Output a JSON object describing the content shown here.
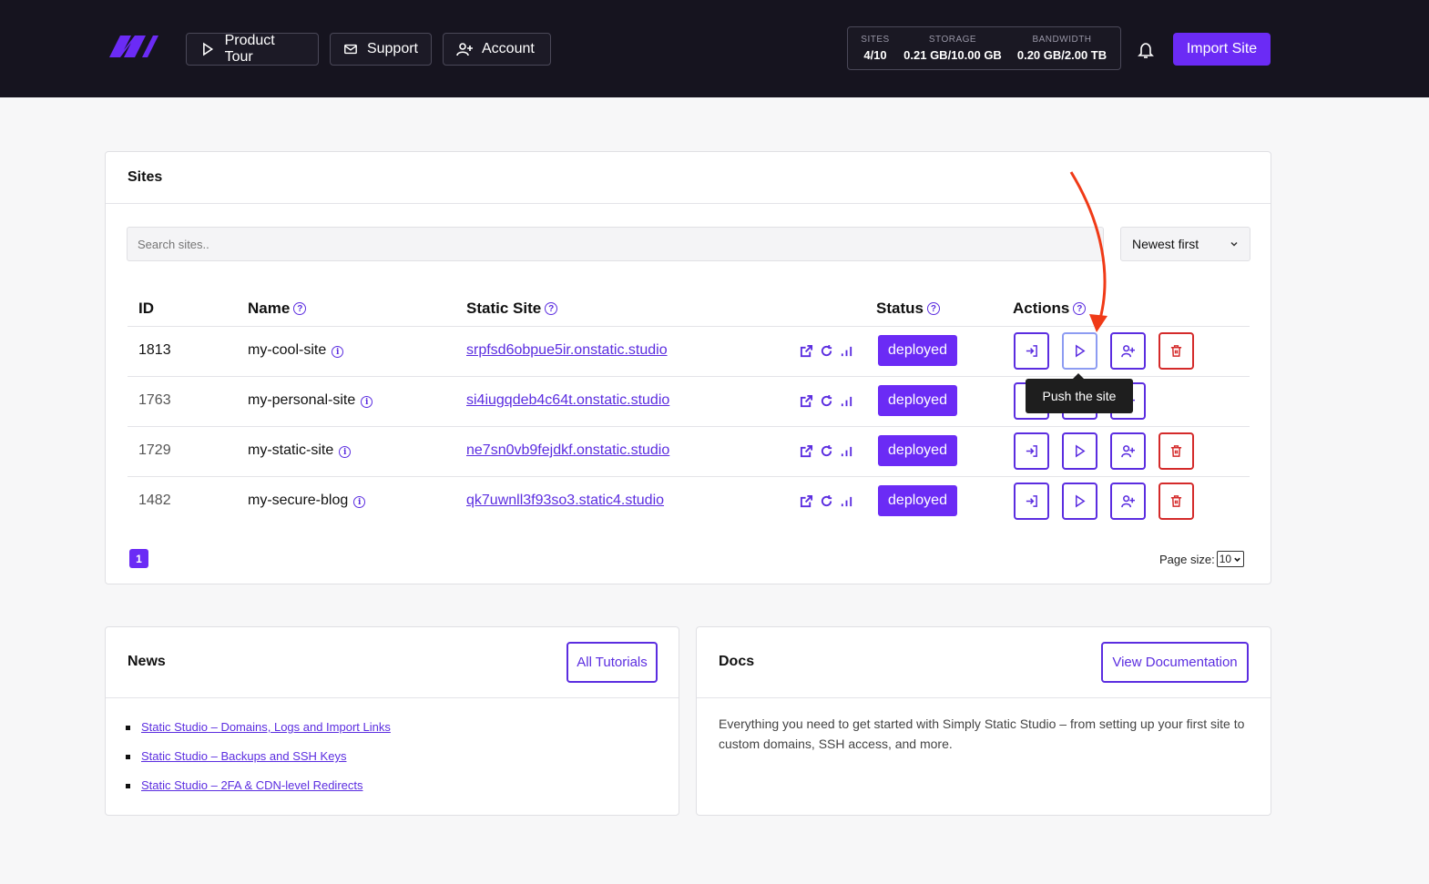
{
  "colors": {
    "brand": "#6b2bf5",
    "header_bg": "#16141f",
    "danger": "#d42a2a",
    "annotation": "#f03a17"
  },
  "header": {
    "nav": [
      {
        "label": "Product Tour",
        "icon": "play-icon"
      },
      {
        "label": "Support",
        "icon": "mail-icon"
      },
      {
        "label": "Account",
        "icon": "user-plus-icon"
      }
    ],
    "stats": [
      {
        "label": "SITES",
        "value": "4/10"
      },
      {
        "label": "STORAGE",
        "value": "0.21 GB/10.00 GB"
      },
      {
        "label": "BANDWIDTH",
        "value": "0.20 GB/2.00 TB"
      }
    ],
    "import_label": "Import Site"
  },
  "sites": {
    "title": "Sites",
    "search_placeholder": "Search sites..",
    "sort_value": "Newest first",
    "columns": {
      "id": "ID",
      "name": "Name",
      "static": "Static Site",
      "status": "Status",
      "actions": "Actions"
    },
    "rows": [
      {
        "id": "1813",
        "name": "my-cool-site",
        "url": "srpfsd6obpue5ir.onstatic.studio",
        "status": "deployed"
      },
      {
        "id": "1763",
        "name": "my-personal-site",
        "url": "si4iugqdeb4c64t.onstatic.studio",
        "status": "deployed"
      },
      {
        "id": "1729",
        "name": "my-static-site",
        "url": "ne7sn0vb9fejdkf.onstatic.studio",
        "status": "deployed"
      },
      {
        "id": "1482",
        "name": "my-secure-blog",
        "url": "qk7uwnll3f93so3.static4.studio",
        "status": "deployed"
      }
    ],
    "tooltip": "Push the site",
    "page": "1",
    "page_size_label": "Page size:",
    "page_size_value": "10"
  },
  "news": {
    "title": "News",
    "button": "All Tutorials",
    "items": [
      "Static Studio – Domains, Logs and Import Links",
      "Static Studio – Backups and SSH Keys",
      "Static Studio – 2FA & CDN-level Redirects"
    ]
  },
  "docs": {
    "title": "Docs",
    "button": "View Documentation",
    "text": "Everything you need to get started with Simply Static Studio – from setting up your first site to custom domains, SSH access, and more."
  }
}
